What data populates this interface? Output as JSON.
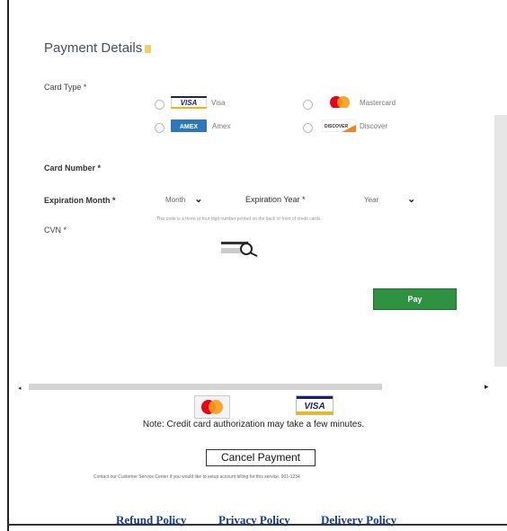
{
  "form": {
    "title": "Payment Details",
    "card_type_label": "Card Type *",
    "card_types": [
      {
        "label": "Visa",
        "logo_text": "VISA"
      },
      {
        "label": "Mastercard"
      },
      {
        "label": "Amex",
        "logo_text": "AMEX"
      },
      {
        "label": "Discover",
        "logo_text": "DISCOVER"
      }
    ],
    "card_number_label": "Card Number *",
    "exp_month_label": "Expiration Month *",
    "exp_month_value": "Month",
    "exp_year_label": "Expiration Year *",
    "exp_year_value": "Year",
    "cvn_label": "CVN *",
    "cvn_hint": "This code is a three or four digit number printed on the back or front of credit cards.",
    "pay_label": "Pay"
  },
  "footer": {
    "visa_logo_text": "VISA",
    "note": "Note: Credit card authorization may take a few minutes.",
    "cancel_label": "Cancel Payment",
    "contact_text": "Contact our Customer Service Center if you would like to setup account billing for this service. 901-1234",
    "links": [
      "Refund Policy",
      "Privacy Policy",
      "Delivery Policy"
    ]
  },
  "scrollbar": {
    "left_arrow": "◂",
    "right_arrow": "▸"
  },
  "colors": {
    "pay_green": "#2e9240",
    "link_blue": "#1a3a8a",
    "visa_blue": "#1a1f71",
    "mc_red": "#eb001b",
    "mc_orange": "#f79e1b"
  }
}
